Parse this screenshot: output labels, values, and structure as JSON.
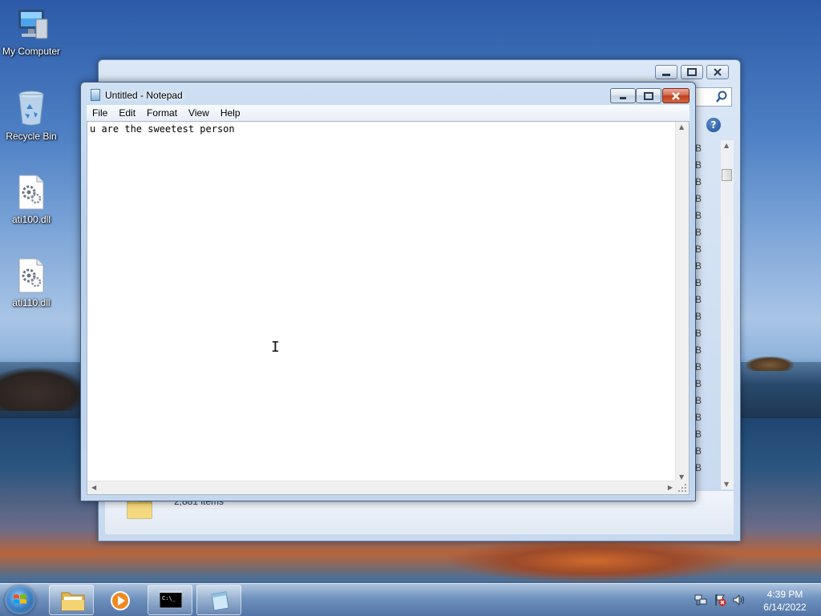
{
  "desktop": {
    "icons": [
      {
        "label": "My Computer",
        "icon": "computer-icon"
      },
      {
        "label": "Recycle Bin",
        "icon": "recycle-bin-icon"
      },
      {
        "label": "ati100.dll",
        "icon": "dll-file-icon"
      },
      {
        "label": "ati110.dll",
        "icon": "dll-file-icon"
      }
    ]
  },
  "explorer": {
    "status_text": "2,881 items",
    "size_column_glyphs": [
      "B",
      "B",
      "B",
      "B",
      "B",
      "B",
      "B",
      "B",
      "B",
      "B",
      "B",
      "B",
      "B",
      "B",
      "B",
      "B",
      "B",
      "B",
      "B",
      "B"
    ]
  },
  "notepad": {
    "title": "Untitled - Notepad",
    "menu": [
      "File",
      "Edit",
      "Format",
      "View",
      "Help"
    ],
    "content": "u are the sweetest person"
  },
  "taskbar": {
    "pinned": [
      {
        "name": "windows-explorer",
        "icon": "folder-icon"
      },
      {
        "name": "media-player",
        "icon": "media-player-icon"
      },
      {
        "name": "command-prompt",
        "icon": "cmd-icon"
      },
      {
        "name": "notepad",
        "icon": "notepad-icon"
      }
    ],
    "clock": {
      "time": "4:39 PM",
      "date": "6/14/2022"
    },
    "tray_icons": [
      "network-icon",
      "action-center-icon",
      "volume-icon"
    ]
  },
  "colors": {
    "title_bar": "#c5d7ee",
    "close_button": "#c2401f",
    "taskbar": "#6f93c2"
  }
}
